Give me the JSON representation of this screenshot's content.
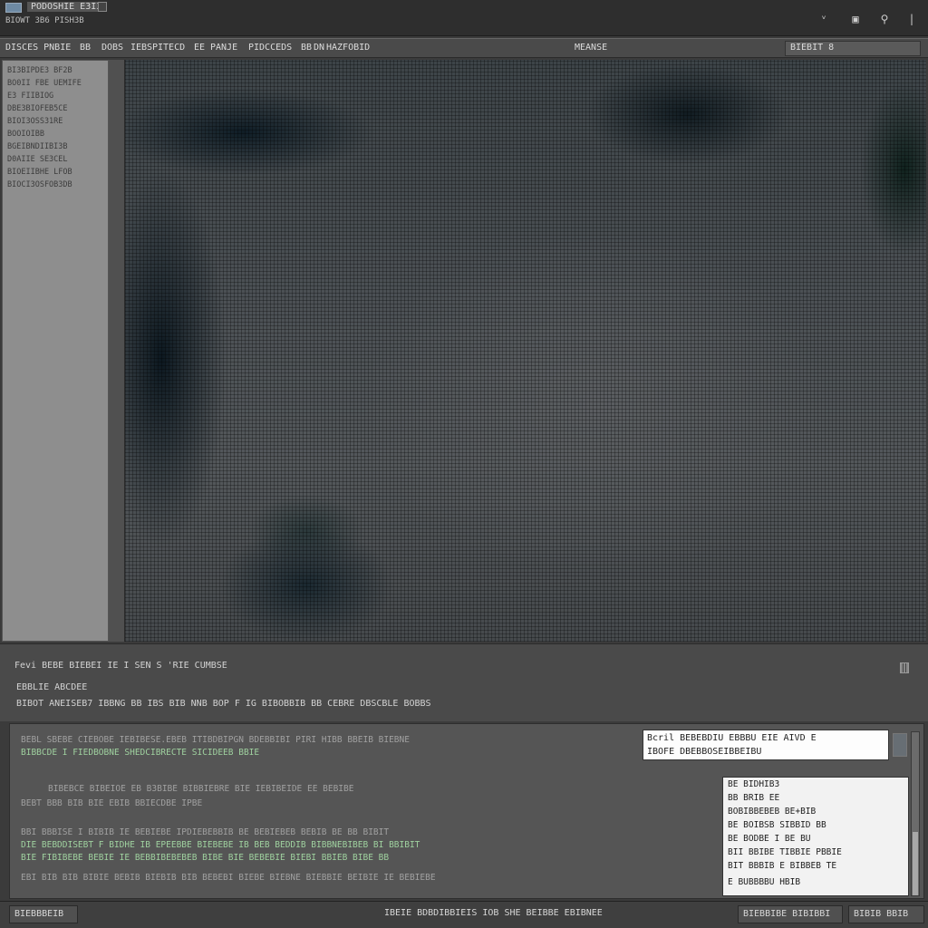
{
  "window": {
    "title": "PODOSHIE E3I3",
    "subtitle": "BIOWT 3B6 PISH3B",
    "controls": {
      "minimize": "ᵛ",
      "maximize": "▣",
      "options": "⚲",
      "close": "|"
    }
  },
  "menubar": {
    "items": [
      "DISCES PNBIE",
      "BB",
      "DOBS",
      "IEBS",
      "PITECD",
      "EE",
      "PANJE",
      "PIDCCEDS",
      "BB",
      "DN",
      "HAZFOBID"
    ],
    "center_label": "MEANSE",
    "right_label": "BIEBIT 8"
  },
  "sidebar": {
    "items": [
      "BI3BIPDE3 BF2B",
      "BO0II FBE UEMIFE",
      "E3 FIIBIOG",
      "DBE3BIOFEB5CE",
      "BIOI3OSS31RE",
      "BOOIOIBB",
      "BGEIBNDIIBI3B",
      "D0AIIE SE3CEL",
      "BIOEIIBHE LFOB",
      "BIOCI3OSFOB3DB"
    ]
  },
  "infopanel": {
    "line1": "Fevi BEBE BIEBEI IE I SEN  S 'RIE CUMBSE",
    "line2": "EBBLIE  ABCDEE",
    "line3": "BIBOT   ANEISEB7  IBBNG   BB   IBS   BIB   NNB   BOP  F IG  BIBOBBIB   BB   CEBRE  DBSCBLE  BOBBS"
  },
  "console": {
    "lines": [
      {
        "text": "BEBL   SBEBE  CIEBOBE       IEBIBESE.EBEB ITIBDBIPGN   BDEBBIBI   PIRI HIBB    BBEIB  BIEBNE",
        "tone": "dim"
      },
      {
        "text": "BIBBCDE I   FIEDBOBNE    SHEDCIBRECTE  SICIDEEB BBIE",
        "tone": "g"
      },
      {
        "text": "BIBEBCE  BIBEIOE    EB    B3BIBE  BIBBIEBRE  BIE  IEBIBEIDE  EE  BEBIBE",
        "tone": "dim"
      },
      {
        "text": "BEBT   BBB BIB         BIE   EBIB   BBIECDBE   IPBE",
        "tone": "dim"
      },
      {
        "text": "BBI   BBBISE  I  BIBIB       IE  BEBIEBE  IPDIEBEBBIB  BE  BEBIEBEB  BEBIB  BE  BB   BIBIT",
        "tone": "dim"
      },
      {
        "text": "DIE   BEBDDISEBT   F   BIDHE  IB  EPEEBBE  BIEBEBE  IB  BEB BEDDIB BIBBNEBIBEB  BI  BBIBIT",
        "tone": "g"
      },
      {
        "text": "BIE  FIBIBEBE  BEBIE  IE  BEBBIBEBEBEB  BIBE BIE BEBEBIE  BIEBI BBIEB  BIBE  BB",
        "tone": "g"
      },
      {
        "text": "EBI  BIB   BIB    BIBIE BEBIB   BIEBIB   BIB BEBEBI  BIEBE  BIEBNE BIEBBIE  BEIBIE  IE BEBIEBE",
        "tone": "dim"
      }
    ],
    "popup": {
      "line1": "Bcril  BEBEBDIU  EBBBU  EIE  AIVD E",
      "line2": "IBOFE  DBEBBOSEIBBEIBU"
    },
    "list": [
      "BE BIDHIB3",
      "BB   BRIB   EE",
      "BOBIBBEBEB  BE+BIB",
      "BE  BOIBSB   SIBBID  BB",
      "BE  BODBE  I  BE  BU",
      "BII  BBIBE   TIBBIE  PBBIE",
      "BIT  BBBIB  E  BIBBEB  TE",
      "E  BUBBBBU  HBIB"
    ]
  },
  "statusbar": {
    "left": "BIEBBBEIB",
    "center": "IBEIE  BDBDIBBIEIS  IOB SHE  BEIBBE  EBIBNEE",
    "right1": "BIEBBIBE  BIBIBBI",
    "right2": "BIBIB  BBIB"
  }
}
